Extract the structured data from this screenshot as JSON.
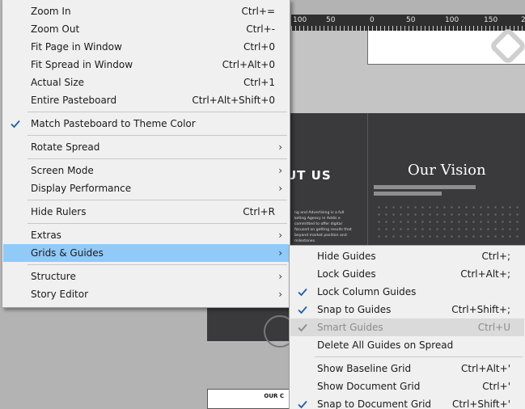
{
  "ruler": {
    "labels": [
      "100",
      "50",
      "0",
      "50",
      "100",
      "150",
      "2"
    ]
  },
  "document": {
    "about_heading": "UT US",
    "about_body": "ng and Advertising is a full keting Agency in Addis e committed to offer digital focused on getting results that beyond market position and milestones.",
    "vision_title": "Our Vision",
    "bottom_label": "OUR C"
  },
  "view_menu": {
    "items": [
      {
        "label": "Zoom In",
        "shortcut": "Ctrl+="
      },
      {
        "label": "Zoom Out",
        "shortcut": "Ctrl+-"
      },
      {
        "label": "Fit Page in Window",
        "shortcut": "Ctrl+0"
      },
      {
        "label": "Fit Spread in Window",
        "shortcut": "Ctrl+Alt+0"
      },
      {
        "label": "Actual Size",
        "shortcut": "Ctrl+1"
      },
      {
        "label": "Entire Pasteboard",
        "shortcut": "Ctrl+Alt+Shift+0"
      },
      {
        "label": "Match Pasteboard to Theme Color",
        "checked": true
      },
      {
        "label": "Rotate Spread",
        "submenu": true
      },
      {
        "label": "Screen Mode",
        "submenu": true
      },
      {
        "label": "Display Performance",
        "submenu": true
      },
      {
        "label": "Hide Rulers",
        "shortcut": "Ctrl+R"
      },
      {
        "label": "Extras",
        "submenu": true
      },
      {
        "label": "Grids & Guides",
        "submenu": true,
        "highlighted": true
      },
      {
        "label": "Structure",
        "submenu": true
      },
      {
        "label": "Story Editor",
        "submenu": true
      }
    ],
    "arrow_glyph": "›"
  },
  "grids_guides_menu": {
    "items": [
      {
        "label": "Hide Guides",
        "shortcut": "Ctrl+;"
      },
      {
        "label": "Lock Guides",
        "shortcut": "Ctrl+Alt+;"
      },
      {
        "label": "Lock Column Guides",
        "checked": true
      },
      {
        "label": "Snap to Guides",
        "shortcut": "Ctrl+Shift+;",
        "checked": true
      },
      {
        "label": "Smart Guides",
        "shortcut": "Ctrl+U",
        "checked": true,
        "disabled": true
      },
      {
        "label": "Delete All Guides on Spread"
      },
      {
        "label": "Show Baseline Grid",
        "shortcut": "Ctrl+Alt+'"
      },
      {
        "label": "Show Document Grid",
        "shortcut": "Ctrl+'"
      },
      {
        "label": "Snap to Document Grid",
        "shortcut": "Ctrl+Shift+'",
        "checked": true
      }
    ]
  },
  "colors": {
    "highlight": "#91c9f7",
    "menu_bg": "#f0f0f0",
    "check": "#1f5fa8",
    "check_disabled": "#8a8a8a"
  },
  "icons": {
    "check": "checkmark-icon",
    "submenu": "chevron-right-icon"
  }
}
